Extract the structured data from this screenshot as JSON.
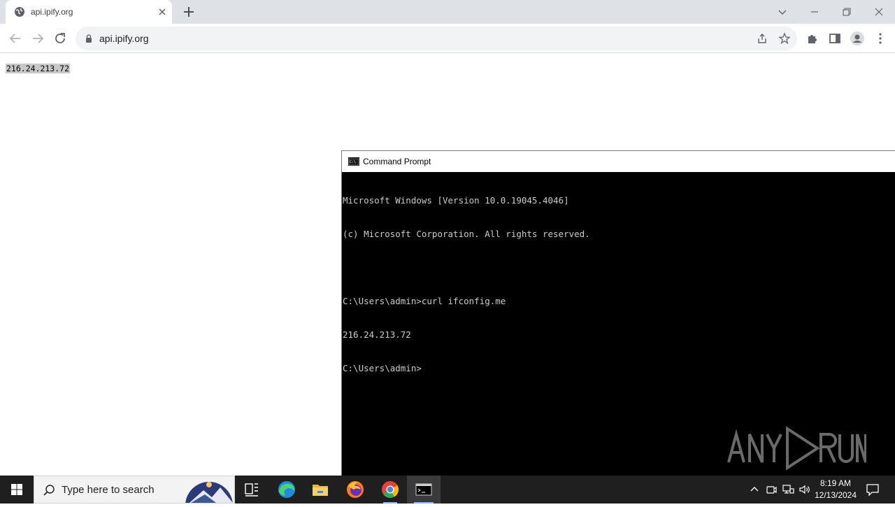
{
  "browser": {
    "tab": {
      "title": "api.ipify.org"
    },
    "address_bar": {
      "url": "api.ipify.org"
    }
  },
  "page": {
    "content_text": "216.24.213.72"
  },
  "cmd": {
    "title": "Command Prompt",
    "lines": [
      "Microsoft Windows [Version 10.0.19045.4046]",
      "(c) Microsoft Corporation. All rights reserved.",
      "",
      "C:\\Users\\admin>curl ifconfig.me",
      "216.24.213.72",
      "C:\\Users\\admin>"
    ],
    "watermark": "ANY RUN"
  },
  "taskbar": {
    "search_placeholder": "Type here to search",
    "clock": {
      "time": "8:19 AM",
      "date": "12/13/2024"
    }
  },
  "colors": {
    "tabstrip": "#dee1e6",
    "omnibox": "#f1f3f4",
    "taskbar": "#1f1f1f",
    "cmd_bg": "#000000",
    "cmd_text": "#cccccc"
  }
}
